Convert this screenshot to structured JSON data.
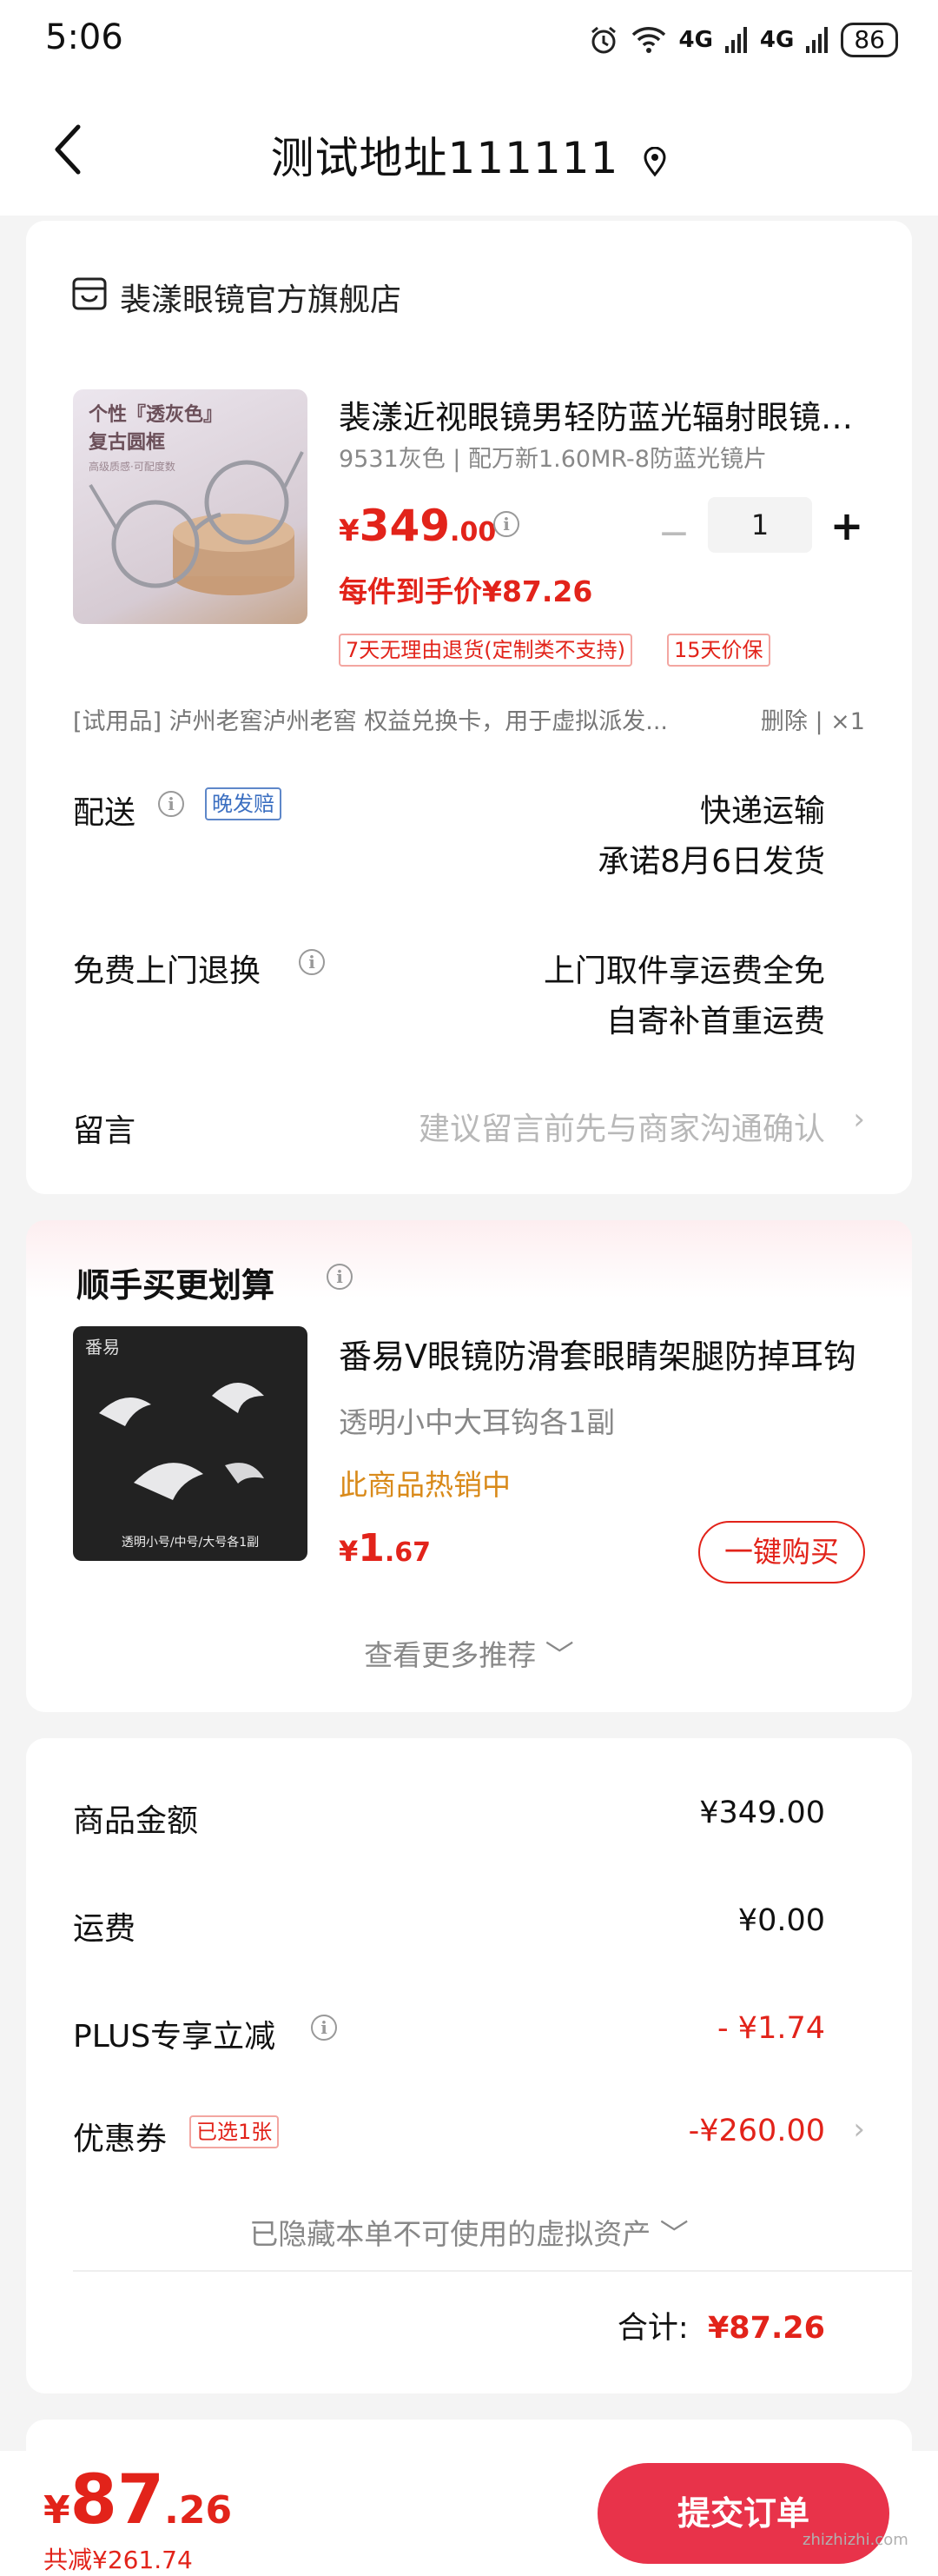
{
  "status_bar": {
    "time": "5:06",
    "signal1": "4G",
    "signal2": "4G",
    "battery": "86"
  },
  "header": {
    "title": "测试地址111111"
  },
  "order": {
    "store_name": "裴漾眼镜官方旗舰店",
    "product": {
      "thumb_line1": "个性『透灰色』",
      "thumb_line2": "复古圆框",
      "thumb_line3": "高级质感·可配度数",
      "title": "裴漾近视眼镜男轻防蓝光辐射眼镜女款",
      "spec": "9531灰色 | 配万新1.60MR-8防蓝光镜片",
      "price_symbol": "¥",
      "price_int": "349",
      "price_dec": ".00",
      "minus": "−",
      "quantity": "1",
      "plus": "+",
      "unit_price": "每件到手价¥87.26",
      "tags": [
        "7天无理由退货(定制类不支持)",
        "15天价保"
      ]
    },
    "trial_item": "[试用品]  泸州老窖泸州老窖  权益兑换卡，用于虚拟派发...",
    "trial_delete": "删除 | ×1",
    "delivery": {
      "label": "配送",
      "badge": "晚发赔",
      "value1": "快递运输",
      "value2": "承诺8月6日发货"
    },
    "return": {
      "label": "免费上门退换",
      "value1": "上门取件享运费全免",
      "value2": "自寄补首重运费"
    },
    "message": {
      "label": "留言",
      "placeholder": "建议留言前先与商家沟通确认"
    }
  },
  "recommend": {
    "heading": "顺手买更划算",
    "thumb_brand": "番易",
    "thumb_caption": "透明小号/中号/大号各1副",
    "title": "番易V眼镜防滑套眼睛架腿防掉耳钩",
    "spec": "透明小中大耳钩各1副",
    "hot": "此商品热销中",
    "price_symbol": "¥",
    "price_int": "1",
    "price_dec": ".67",
    "buy_label": "一键购买",
    "more_label": "查看更多推荐 ﹀"
  },
  "summary": {
    "goods_label": "商品金额",
    "goods_value": "¥349.00",
    "shipping_label": "运费",
    "shipping_value": "¥0.00",
    "plus_label": "PLUS专享立减",
    "plus_value": "- ¥1.74",
    "coupon_label": "优惠券",
    "coupon_badge": "已选1张",
    "coupon_value": "-¥260.00",
    "hidden_assets": "已隐藏本单不可使用的虚拟资产 ﹀",
    "total_label": "合计:",
    "total_value": "¥87.26"
  },
  "bottom": {
    "price_symbol": "¥",
    "price_int": "87",
    "price_dec": ".26",
    "saved": "共减¥261.74",
    "submit_label": "提交订单"
  },
  "watermark": "zhizhizhi.com",
  "colors": {
    "accent": "#e2231a",
    "submit_bg": "#e8334a",
    "hot": "#d98a1a"
  }
}
